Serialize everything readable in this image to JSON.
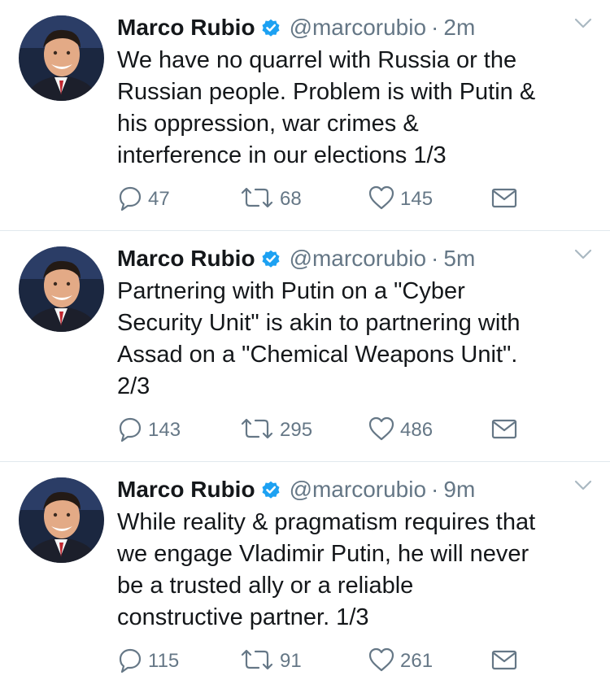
{
  "tweets": [
    {
      "name": "Marco Rubio",
      "handle": "@marcorubio",
      "separator": "·",
      "time": "2m",
      "text": "We have no quarrel with Russia or the\nRussian people. Problem is with Putin &\nhis oppression, war crimes &\ninterference in our elections 1/3",
      "replies": "47",
      "retweets": "68",
      "likes": "145"
    },
    {
      "name": "Marco Rubio",
      "handle": "@marcorubio",
      "separator": "·",
      "time": "5m",
      "text": "Partnering with Putin on a \"Cyber\nSecurity Unit\" is akin to partnering with\nAssad on a \"Chemical Weapons Unit\".\n2/3",
      "replies": "143",
      "retweets": "295",
      "likes": "486"
    },
    {
      "name": "Marco Rubio",
      "handle": "@marcorubio",
      "separator": "·",
      "time": "9m",
      "text": "While reality & pragmatism requires that\nwe engage Vladimir Putin, he will never\nbe a trusted ally or a reliable\nconstructive partner. 1/3",
      "replies": "115",
      "retweets": "91",
      "likes": "261"
    }
  ],
  "icons": {
    "verified": "verified-badge-icon",
    "menu": "chevron-down-icon",
    "reply": "reply-icon",
    "retweet": "retweet-icon",
    "like": "heart-icon",
    "dm": "envelope-icon"
  },
  "colors": {
    "verified": "#1da1f2",
    "icon_gray": "#657786",
    "divider": "#e1e8ed"
  }
}
